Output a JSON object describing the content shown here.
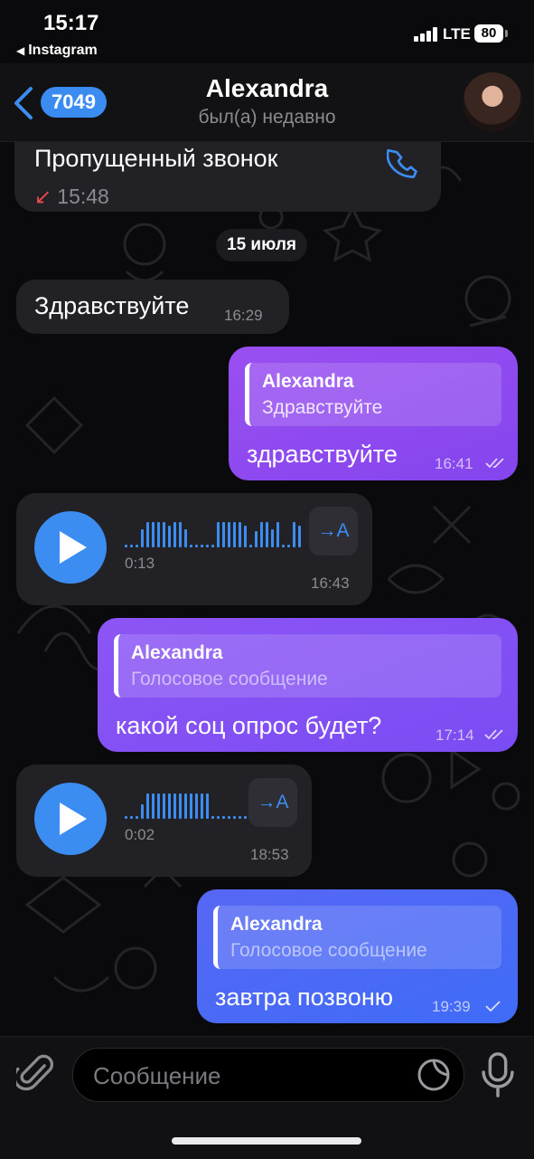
{
  "status_bar": {
    "time": "15:17",
    "back_app": "Instagram",
    "network": "LTE",
    "battery": "80"
  },
  "header": {
    "back_count": "7049",
    "name": "Alexandra",
    "status": "был(а) недавно"
  },
  "messages": {
    "missed_call": {
      "title": "Пропущенный звонок",
      "time": "15:48"
    },
    "date": "15 июля",
    "in1": {
      "text": "Здравствуйте",
      "time": "16:29"
    },
    "out1": {
      "reply_name": "Alexandra",
      "reply_text": "Здравствуйте",
      "text": "здравствуйте",
      "time": "16:41",
      "status": "read"
    },
    "voice1": {
      "duration": "0:13",
      "time": "16:43",
      "transcribe": "→A"
    },
    "out2": {
      "reply_name": "Alexandra",
      "reply_text": "Голосовое сообщение",
      "text": "какой соц опрос будет?",
      "time": "17:14",
      "status": "read"
    },
    "voice2": {
      "duration": "0:02",
      "time": "18:53",
      "transcribe": "→A"
    },
    "out3": {
      "reply_name": "Alexandra",
      "reply_text": "Голосовое сообщение",
      "text": "завтра позвоню",
      "time": "19:39",
      "status": "sent"
    }
  },
  "input": {
    "placeholder": "Сообщение"
  },
  "colors": {
    "accent": "#3c8df1",
    "outgoing_purple": "#8a48ef",
    "outgoing_blue": "#4a69f6",
    "missed_call": "#e94a4a"
  }
}
